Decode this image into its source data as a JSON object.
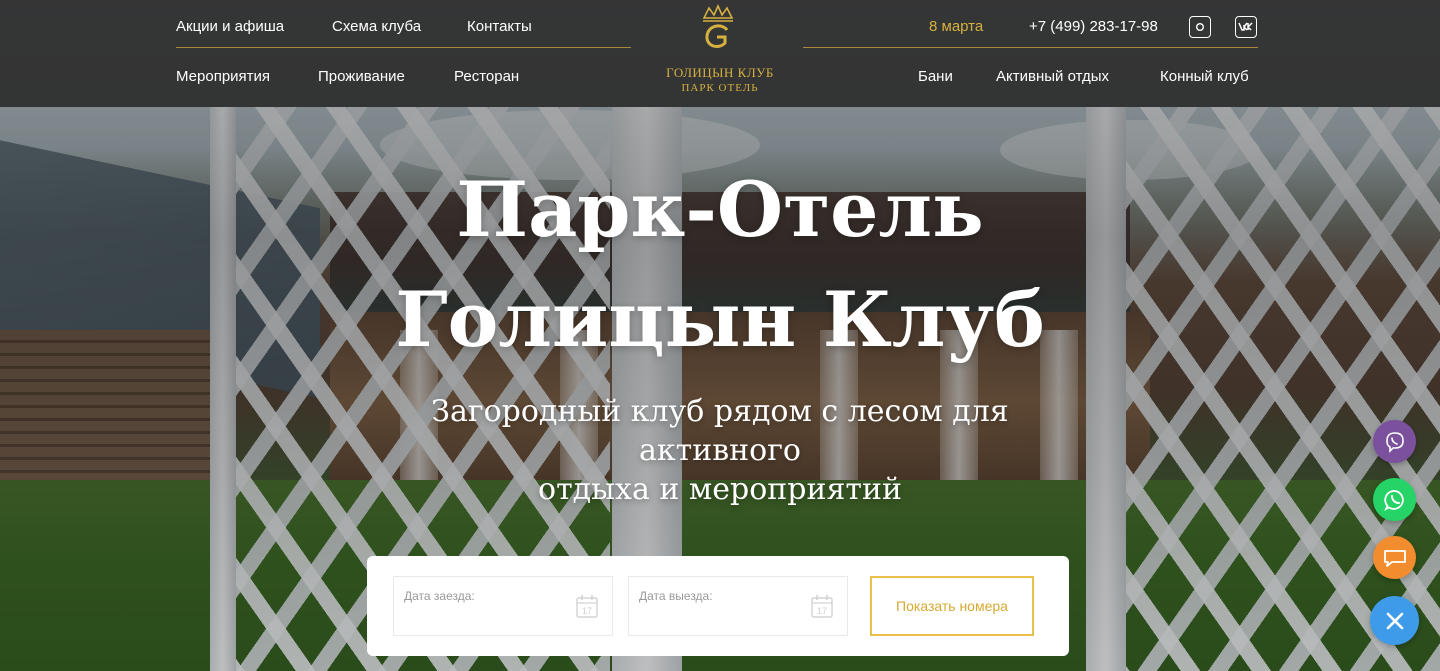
{
  "header": {
    "nav_top_left": [
      "Акции и афиша",
      "Схема клуба",
      "Контакты"
    ],
    "nav_bottom_left": [
      "Мероприятия",
      "Проживание",
      "Ресторан"
    ],
    "nav_bottom_right": [
      "Бани",
      "Активный отдых",
      "Конный клуб"
    ],
    "date_link": "8 марта",
    "phone": "+7 (499) 283-17-98",
    "logo_line1": "ГОЛИЦЫН КЛУБ",
    "logo_line2": "ПАРК ОТЕЛЬ",
    "social": [
      "instagram-icon",
      "vk-icon"
    ],
    "accent_color": "#d6b140"
  },
  "hero": {
    "title_line1": "Парк-Отель",
    "title_line2": "Голицын Клуб",
    "subtitle_line1": "Загородный клуб рядом с лесом для",
    "subtitle_line2": "активного",
    "subtitle_line3": "отдыха и мероприятий"
  },
  "booking": {
    "checkin_label": "Дата заезда:",
    "checkout_label": "Дата выезда:",
    "calendar_day": "17",
    "submit_label": "Показать номера",
    "button_color": "#e9c04a"
  },
  "floating_buttons": [
    {
      "name": "viber-icon",
      "color": "#7b519d"
    },
    {
      "name": "whatsapp-icon",
      "color": "#25d366"
    },
    {
      "name": "chat-icon",
      "color": "#f18d2f"
    },
    {
      "name": "close-icon",
      "color": "#3d9be9"
    }
  ]
}
